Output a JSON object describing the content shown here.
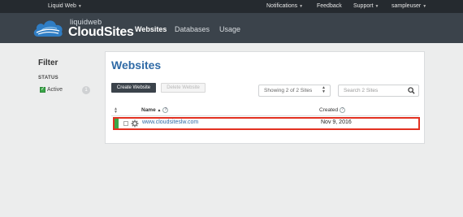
{
  "topbar": {
    "brand_menu": "Liquid Web",
    "notifications": "Notifications",
    "feedback": "Feedback",
    "support": "Support",
    "user": "sampleuser"
  },
  "header": {
    "brand_small": "liquidweb",
    "brand_big": "CloudSites",
    "nav": [
      "Websites",
      "Databases",
      "Usage"
    ],
    "active_nav": "Websites"
  },
  "sidebar": {
    "title": "Filter",
    "status_heading": "STATUS",
    "active_label": "Active",
    "active_count": "1"
  },
  "main": {
    "title": "Websites",
    "create_button": "Create Website",
    "delete_button": "Delete Website",
    "showing_select": "Showing 2 of 2 Sites",
    "search_placeholder": "Search 2 Sites",
    "columns": {
      "name": "Name",
      "created": "Created"
    },
    "rows": [
      {
        "site": "www.cloudsiteslw.com",
        "created": "Nov 9, 2016"
      }
    ]
  },
  "colors": {
    "accent": "#2f6aa6",
    "highlight": "#e23121",
    "status_active": "#3aa648"
  }
}
